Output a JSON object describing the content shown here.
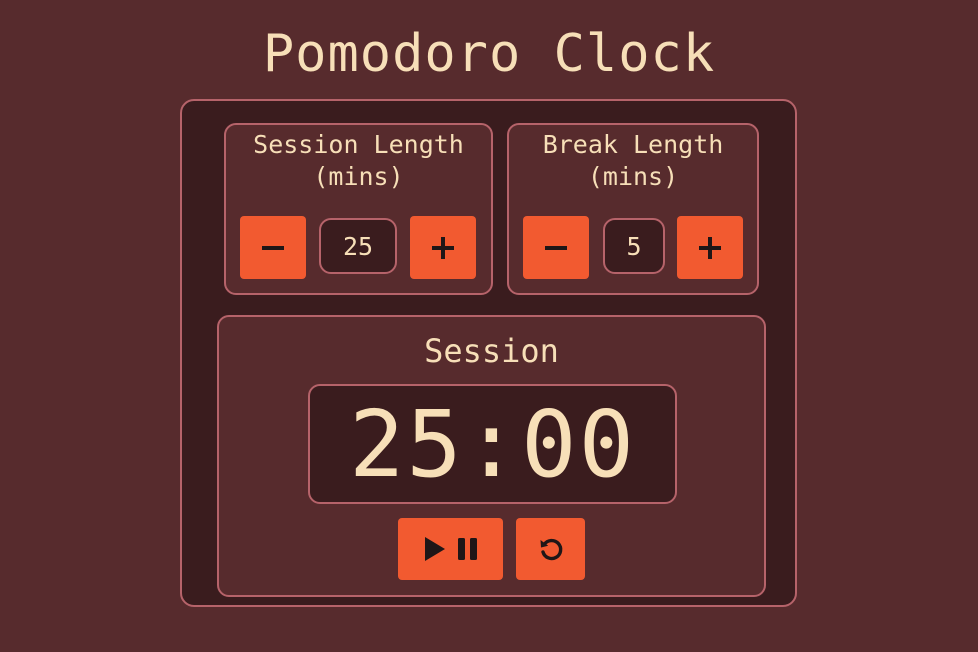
{
  "app": {
    "title": "Pomodoro Clock"
  },
  "session_length": {
    "label": "Session Length (mins)",
    "value": "25"
  },
  "break_length": {
    "label": "Break Length (mins)",
    "value": "5"
  },
  "timer": {
    "label": "Session",
    "time": "25:00"
  },
  "icons": {
    "decrement": "minus-icon",
    "increment": "plus-icon",
    "play": "play-icon",
    "pause": "pause-icon",
    "reset": "reset-icon"
  },
  "colors": {
    "background": "#572b2d",
    "panel": "#3a1c1e",
    "border": "#b6636a",
    "accent": "#f25a30",
    "text": "#f7dfb8",
    "icon": "#1f1617"
  }
}
